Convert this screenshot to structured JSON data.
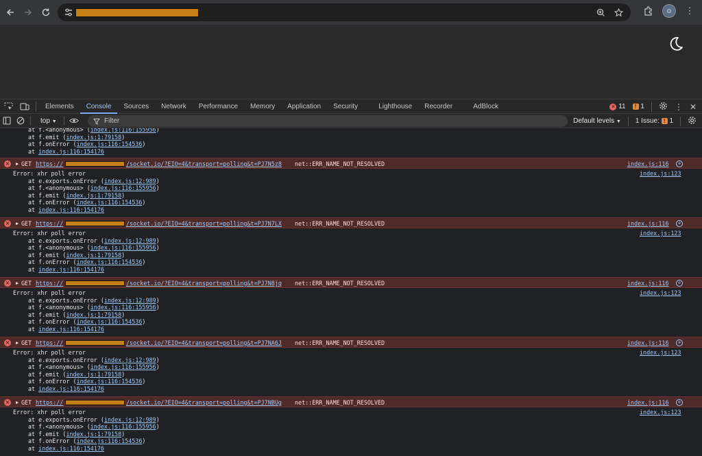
{
  "browser": {
    "back_icon": "arrow-left-icon",
    "forward_icon": "arrow-right-icon",
    "reload_icon": "reload-icon",
    "colors": {
      "redaction": "#c47f17"
    }
  },
  "devtools": {
    "tabs": [
      "Elements",
      "Console",
      "Sources",
      "Network",
      "Performance",
      "Memory",
      "Application",
      "Security",
      "Lighthouse",
      "Recorder",
      "AdBlock"
    ],
    "active_tab": "Console",
    "error_count": "11",
    "warning_count": "1"
  },
  "console_toolbar": {
    "context": "top",
    "filter_placeholder": "Filter",
    "levels": "Default levels",
    "issues_label": "1 Issue:",
    "issues_count": "1"
  },
  "partial_stack": [
    {
      "pre": "at f.<anonymous> (",
      "link": "index.js:116:155956",
      "post": ")"
    },
    {
      "pre": "at f.emit (",
      "link": "index.js:1:79158",
      "post": ")"
    },
    {
      "pre": "at f.onError (",
      "link": "index.js:116:154536",
      "post": ")"
    },
    {
      "pre": "at ",
      "link": "index.js:116:154176",
      "post": ""
    }
  ],
  "errors": [
    {
      "method": "GET",
      "url_prefix": "https://",
      "url_suffix": "/socket.io/?EIO=4&transport=polling&t=PJ7N5z8",
      "message": "net::ERR_NAME_NOT_RESOLVED",
      "source": "index.js:116",
      "detail": "Error: xhr poll error",
      "detail_source": "index.js:123",
      "stack": [
        {
          "pre": "at e.exports.onError (",
          "link": "index.js:12:989",
          "post": ")"
        },
        {
          "pre": "at f.<anonymous> (",
          "link": "index.js:116:155956",
          "post": ")"
        },
        {
          "pre": "at f.emit (",
          "link": "index.js:1:79158",
          "post": ")"
        },
        {
          "pre": "at f.onError (",
          "link": "index.js:116:154536",
          "post": ")"
        },
        {
          "pre": "at ",
          "link": "index.js:116:154176",
          "post": ""
        }
      ]
    },
    {
      "method": "GET",
      "url_prefix": "https://",
      "url_suffix": "/socket.io/?EIO=4&transport=polling&t=PJ7N7LX",
      "message": "net::ERR_NAME_NOT_RESOLVED",
      "source": "index.js:116",
      "detail": "Error: xhr poll error",
      "detail_source": "index.js:123",
      "stack": [
        {
          "pre": "at e.exports.onError (",
          "link": "index.js:12:989",
          "post": ")"
        },
        {
          "pre": "at f.<anonymous> (",
          "link": "index.js:116:155956",
          "post": ")"
        },
        {
          "pre": "at f.emit (",
          "link": "index.js:1:79158",
          "post": ")"
        },
        {
          "pre": "at f.onError (",
          "link": "index.js:116:154536",
          "post": ")"
        },
        {
          "pre": "at ",
          "link": "index.js:116:154176",
          "post": ""
        }
      ]
    },
    {
      "method": "GET",
      "url_prefix": "https://",
      "url_suffix": "/socket.io/?EIO=4&transport=polling&t=PJ7N8jq",
      "message": "net::ERR_NAME_NOT_RESOLVED",
      "source": "index.js:116",
      "detail": "Error: xhr poll error",
      "detail_source": "index.js:123",
      "stack": [
        {
          "pre": "at e.exports.onError (",
          "link": "index.js:12:989",
          "post": ")"
        },
        {
          "pre": "at f.<anonymous> (",
          "link": "index.js:116:155956",
          "post": ")"
        },
        {
          "pre": "at f.emit (",
          "link": "index.js:1:79158",
          "post": ")"
        },
        {
          "pre": "at f.onError (",
          "link": "index.js:116:154536",
          "post": ")"
        },
        {
          "pre": "at ",
          "link": "index.js:116:154176",
          "post": ""
        }
      ]
    },
    {
      "method": "GET",
      "url_prefix": "https://",
      "url_suffix": "/socket.io/?EIO=4&transport=polling&t=PJ7NA6J",
      "message": "net::ERR_NAME_NOT_RESOLVED",
      "source": "index.js:116",
      "detail": "Error: xhr poll error",
      "detail_source": "index.js:123",
      "stack": [
        {
          "pre": "at e.exports.onError (",
          "link": "index.js:12:989",
          "post": ")"
        },
        {
          "pre": "at f.<anonymous> (",
          "link": "index.js:116:155956",
          "post": ")"
        },
        {
          "pre": "at f.emit (",
          "link": "index.js:1:79158",
          "post": ")"
        },
        {
          "pre": "at f.onError (",
          "link": "index.js:116:154536",
          "post": ")"
        },
        {
          "pre": "at ",
          "link": "index.js:116:154176",
          "post": ""
        }
      ]
    },
    {
      "method": "GET",
      "url_prefix": "https://",
      "url_suffix": "/socket.io/?EIO=4&transport=polling&t=PJ7NBUg",
      "message": "net::ERR_NAME_NOT_RESOLVED",
      "source": "index.js:116",
      "detail": "Error: xhr poll error",
      "detail_source": "index.js:123",
      "stack": [
        {
          "pre": "at e.exports.onError (",
          "link": "index.js:12:989",
          "post": ")"
        },
        {
          "pre": "at f.<anonymous> (",
          "link": "index.js:116:155956",
          "post": ")"
        },
        {
          "pre": "at f.emit (",
          "link": "index.js:1:79158",
          "post": ")"
        },
        {
          "pre": "at f.onError (",
          "link": "index.js:116:154536",
          "post": ")"
        },
        {
          "pre": "at ",
          "link": "index.js:116:154176",
          "post": ""
        }
      ]
    }
  ]
}
